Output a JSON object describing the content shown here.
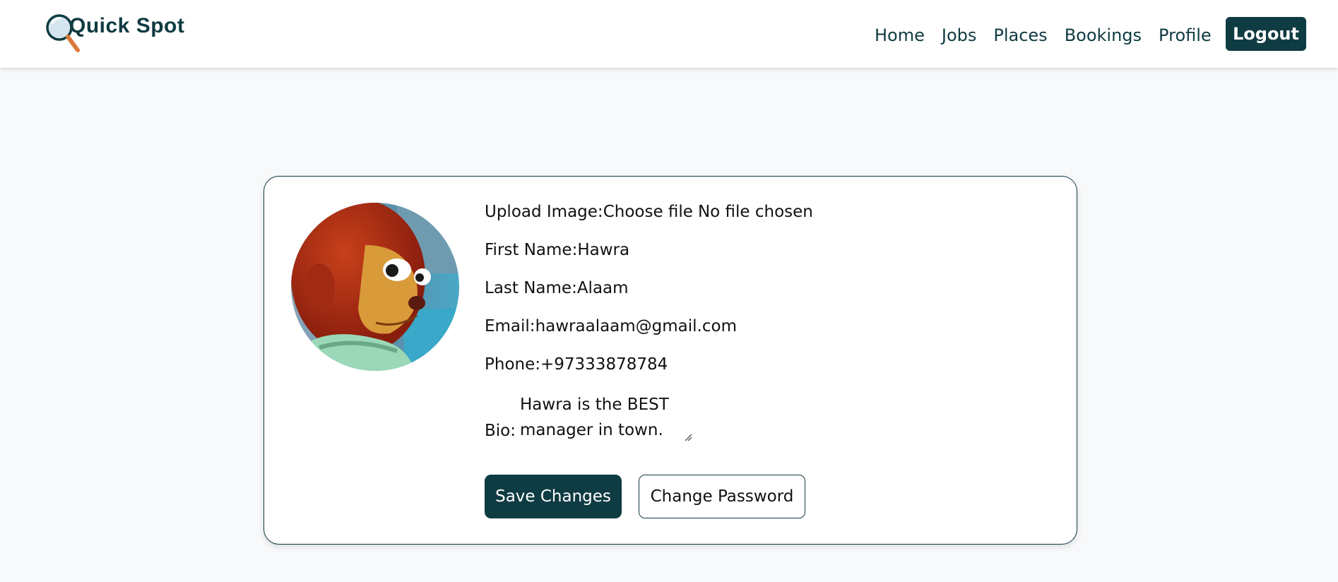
{
  "brand": {
    "name": "Quick Spot",
    "icon": "magnifier-icon",
    "color": "#0f3b42"
  },
  "nav": {
    "items": [
      {
        "label": "Home"
      },
      {
        "label": "Jobs"
      },
      {
        "label": "Places"
      },
      {
        "label": "Bookings"
      },
      {
        "label": "Profile"
      }
    ],
    "logout_label": "Logout"
  },
  "profile": {
    "avatar_icon": "profile-photo",
    "upload_label": "Upload Image:",
    "upload_button": "Choose file",
    "upload_status": "No file chosen",
    "first_name_label": "First Name:",
    "first_name": "Hawra",
    "last_name_label": "Last Name:",
    "last_name": "Alaam",
    "email_label": "Email:",
    "email": "hawraalaam@gmail.com",
    "phone_label": "Phone:",
    "phone": "+97333878784",
    "bio_label": "Bio:",
    "bio": "Hawra is the BEST manager in town."
  },
  "actions": {
    "save_label": "Save Changes",
    "change_password_label": "Change Password"
  },
  "colors": {
    "accent": "#0f3b42",
    "background": "#f8f9fa"
  }
}
